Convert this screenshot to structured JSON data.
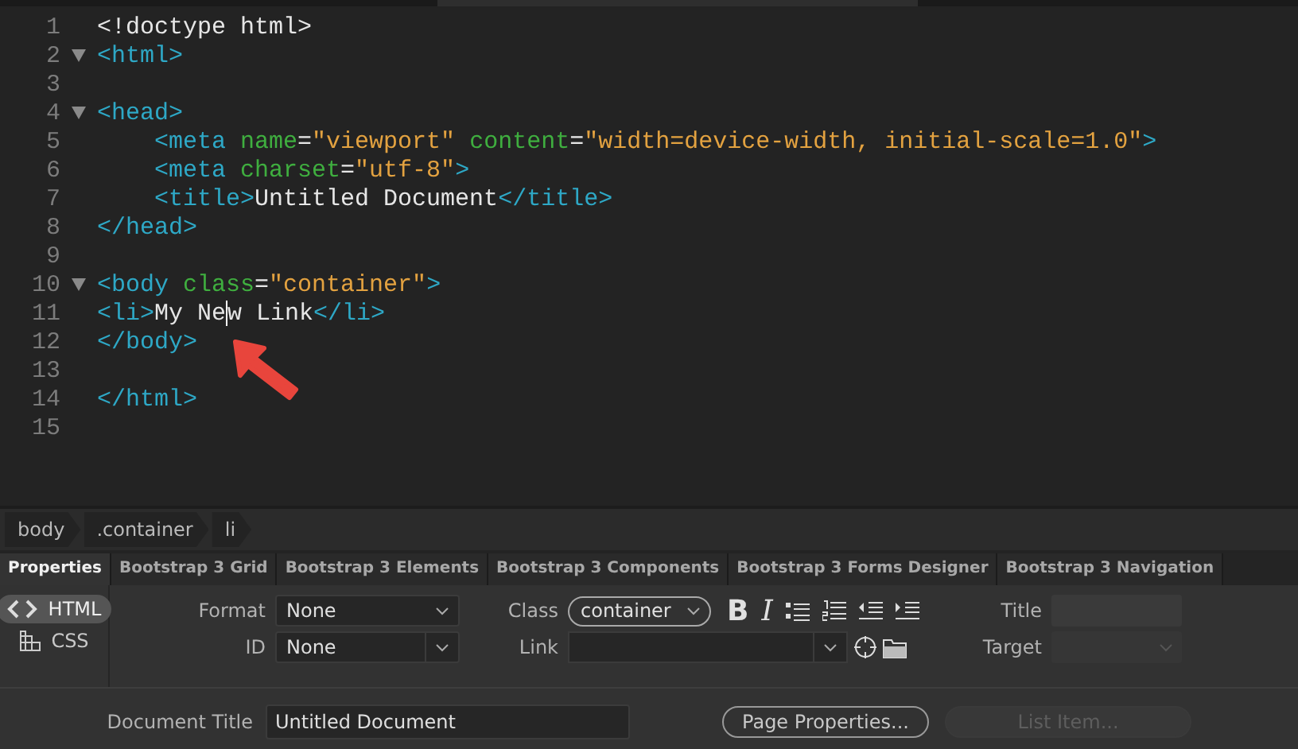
{
  "editor": {
    "lines": [
      {
        "number": "1",
        "tokens": [
          {
            "kind": "plain",
            "text": "<!doctype html>"
          }
        ]
      },
      {
        "number": "2",
        "foldable": true,
        "tokens": [
          {
            "kind": "tag",
            "text": "<html>"
          }
        ]
      },
      {
        "number": "3"
      },
      {
        "number": "4",
        "foldable": true,
        "tokens": [
          {
            "kind": "tag",
            "text": "<head>"
          }
        ]
      },
      {
        "number": "5",
        "tokens": [
          {
            "kind": "tag",
            "text": "    <meta"
          },
          {
            "kind": "attr",
            "text": " name"
          },
          {
            "kind": "plain",
            "text": "="
          },
          {
            "kind": "value",
            "text": "\"viewport\""
          },
          {
            "kind": "attr",
            "text": " content"
          },
          {
            "kind": "plain",
            "text": "="
          },
          {
            "kind": "value",
            "text": "\"width=device-width, initial-scale=1.0\""
          },
          {
            "kind": "tag",
            "text": ">"
          }
        ]
      },
      {
        "number": "6",
        "tokens": [
          {
            "kind": "tag",
            "text": "    <meta"
          },
          {
            "kind": "attr",
            "text": " charset"
          },
          {
            "kind": "plain",
            "text": "="
          },
          {
            "kind": "value",
            "text": "\"utf-8\""
          },
          {
            "kind": "tag",
            "text": ">"
          }
        ]
      },
      {
        "number": "7",
        "tokens": [
          {
            "kind": "tag",
            "text": "    <title>"
          },
          {
            "kind": "plain",
            "text": "Untitled Document"
          },
          {
            "kind": "tag",
            "text": "</title>"
          }
        ]
      },
      {
        "number": "8",
        "tokens": [
          {
            "kind": "tag",
            "text": "</head>"
          }
        ]
      },
      {
        "number": "9"
      },
      {
        "number": "10",
        "foldable": true,
        "tokens": [
          {
            "kind": "tag",
            "text": "<body"
          },
          {
            "kind": "attr",
            "text": " class"
          },
          {
            "kind": "plain",
            "text": "="
          },
          {
            "kind": "value",
            "text": "\"container\""
          },
          {
            "kind": "tag",
            "text": ">"
          }
        ]
      },
      {
        "number": "11",
        "tokens": [
          {
            "kind": "tag",
            "text": "<li>"
          },
          {
            "kind": "plain",
            "text": "My Ne",
            "cursor_after": true
          },
          {
            "kind": "plain",
            "text": "w Link"
          },
          {
            "kind": "tag",
            "text": "</li>"
          }
        ]
      },
      {
        "number": "12",
        "tokens": [
          {
            "kind": "tag",
            "text": "</body>"
          }
        ]
      },
      {
        "number": "13"
      },
      {
        "number": "14",
        "tokens": [
          {
            "kind": "tag",
            "text": "</html>"
          }
        ]
      },
      {
        "number": "15"
      }
    ]
  },
  "breadcrumb": [
    {
      "label": "body"
    },
    {
      "label": ".container"
    },
    {
      "label": "li"
    }
  ],
  "panel_tabs": [
    {
      "label": "Properties",
      "selected": true
    },
    {
      "label": "Bootstrap 3 Grid",
      "selected": false
    },
    {
      "label": "Bootstrap 3 Elements",
      "selected": false
    },
    {
      "label": "Bootstrap 3 Components",
      "selected": false
    },
    {
      "label": "Bootstrap 3 Forms Designer",
      "selected": false
    },
    {
      "label": "Bootstrap 3 Navigation",
      "selected": false
    }
  ],
  "properties": {
    "modes": [
      {
        "kind": "html",
        "label": "HTML",
        "selected": true
      },
      {
        "kind": "css",
        "label": "CSS",
        "selected": false
      }
    ],
    "format": {
      "label": "Format",
      "value": "None"
    },
    "id": {
      "label": "ID",
      "value": "None"
    },
    "class": {
      "label": "Class",
      "value": "container"
    },
    "link": {
      "label": "Link"
    },
    "format_buttons": [
      {
        "kind": "bold",
        "text": "B"
      },
      {
        "kind": "italic",
        "text": "I"
      },
      {
        "kind": "bullets"
      },
      {
        "kind": "numbers"
      },
      {
        "kind": "outdent"
      },
      {
        "kind": "indent"
      }
    ],
    "title": {
      "label": "Title"
    },
    "target": {
      "label": "Target",
      "disabled": true
    },
    "document_title": {
      "label": "Document Title",
      "value": "Untitled Document"
    },
    "buttons": [
      {
        "label": "Page Properties...",
        "disabled": false
      },
      {
        "label": "List Item...",
        "disabled": true
      }
    ]
  }
}
